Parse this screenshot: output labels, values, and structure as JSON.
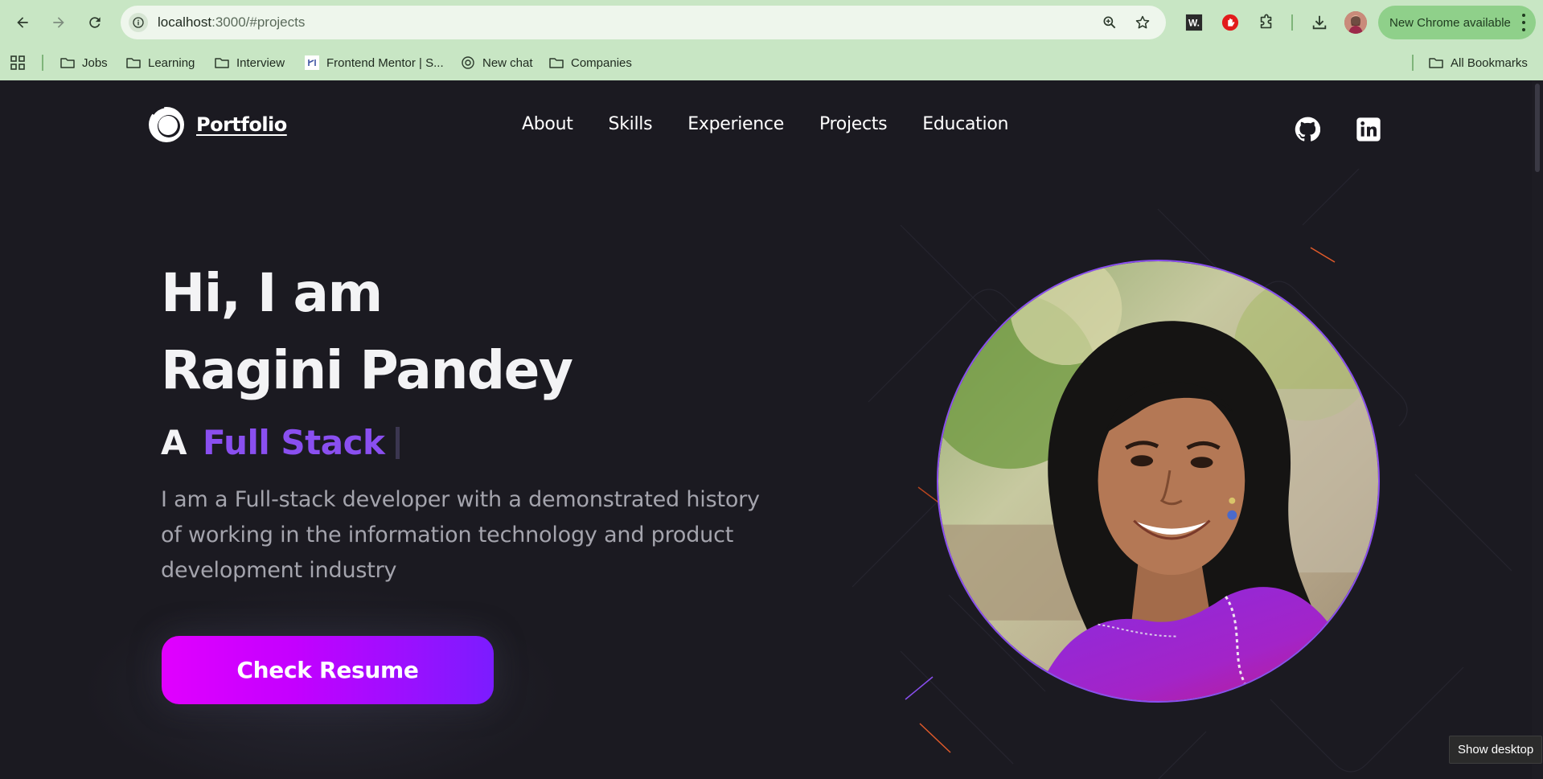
{
  "browser": {
    "url_host": "localhost",
    "url_path": ":3000/#projects",
    "update_label": "New Chrome available",
    "extensions": [
      "w-extension-icon",
      "adblock-icon",
      "puzzle-extensions-icon"
    ],
    "bookmarks": [
      {
        "label": "Jobs",
        "icon": "folder-icon"
      },
      {
        "label": "Learning",
        "icon": "folder-icon"
      },
      {
        "label": "Interview",
        "icon": "folder-icon"
      },
      {
        "label": "Frontend Mentor | S...",
        "icon": "frontend-mentor-icon"
      },
      {
        "label": "New chat",
        "icon": "chatgpt-icon"
      },
      {
        "label": "Companies",
        "icon": "folder-icon"
      }
    ],
    "all_bookmarks_label": "All Bookmarks",
    "accent": "#c8e6c4"
  },
  "site": {
    "logo_text": "Portfolio",
    "nav": [
      "About",
      "Skills",
      "Experience",
      "Projects",
      "Education"
    ],
    "social": [
      "github-icon",
      "linkedin-icon"
    ]
  },
  "hero": {
    "greeting": "Hi, I am",
    "name": "Ragini Pandey",
    "role_prefix": "A",
    "role_accent": "Full Stack",
    "description": "I am a Full-stack developer with a demonstrated history of working in the information technology and product development industry",
    "cta_label": "Check Resume",
    "accent_color": "#8a4ff0",
    "cta_gradient": [
      "#e100ff",
      "#7b1cff"
    ]
  },
  "os": {
    "tooltip": "Show desktop"
  }
}
